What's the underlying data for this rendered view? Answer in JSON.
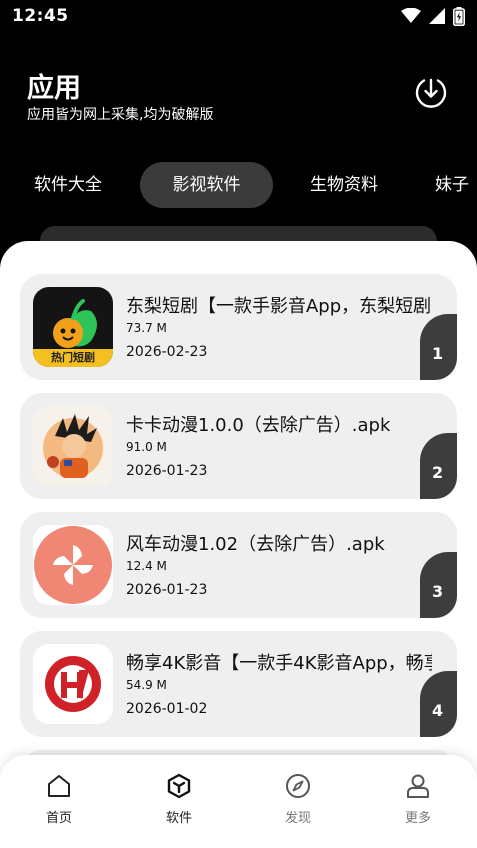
{
  "status_bar": {
    "time": "12:45"
  },
  "header": {
    "title": "应用",
    "subtitle": "应用皆为网上采集,均为破解版"
  },
  "tabs": [
    {
      "label": "软件大全",
      "active": false
    },
    {
      "label": "影视软件",
      "active": true
    },
    {
      "label": "生物资料",
      "active": false
    },
    {
      "label": "妹子",
      "active": false
    }
  ],
  "apps": [
    {
      "name": "东梨短剧【一款手影音App，东梨短剧",
      "size": "73.7 M",
      "date": "2026-02-23",
      "rank": "1",
      "icon_caption": "热门短剧"
    },
    {
      "name": "卡卡动漫1.0.0（去除广告）.apk",
      "size": "91.0 M",
      "date": "2026-01-23",
      "rank": "2"
    },
    {
      "name": "风车动漫1.02（去除广告）.apk",
      "size": "12.4 M",
      "date": "2026-01-23",
      "rank": "3"
    },
    {
      "name": "畅享4K影音【一款手4K影音App，畅享",
      "size": "54.9 M",
      "date": "2026-01-02",
      "rank": "4"
    }
  ],
  "bottom_nav": [
    {
      "label": "首页",
      "icon": "home-icon"
    },
    {
      "label": "软件",
      "icon": "cube-icon"
    },
    {
      "label": "发现",
      "icon": "compass-icon"
    },
    {
      "label": "更多",
      "icon": "user-icon"
    }
  ],
  "colors": {
    "background": "#000000",
    "sheet": "#ffffff",
    "card": "#efefef",
    "active_tab": "#3b3b3b",
    "rank_badge": "#3d3d3d"
  }
}
